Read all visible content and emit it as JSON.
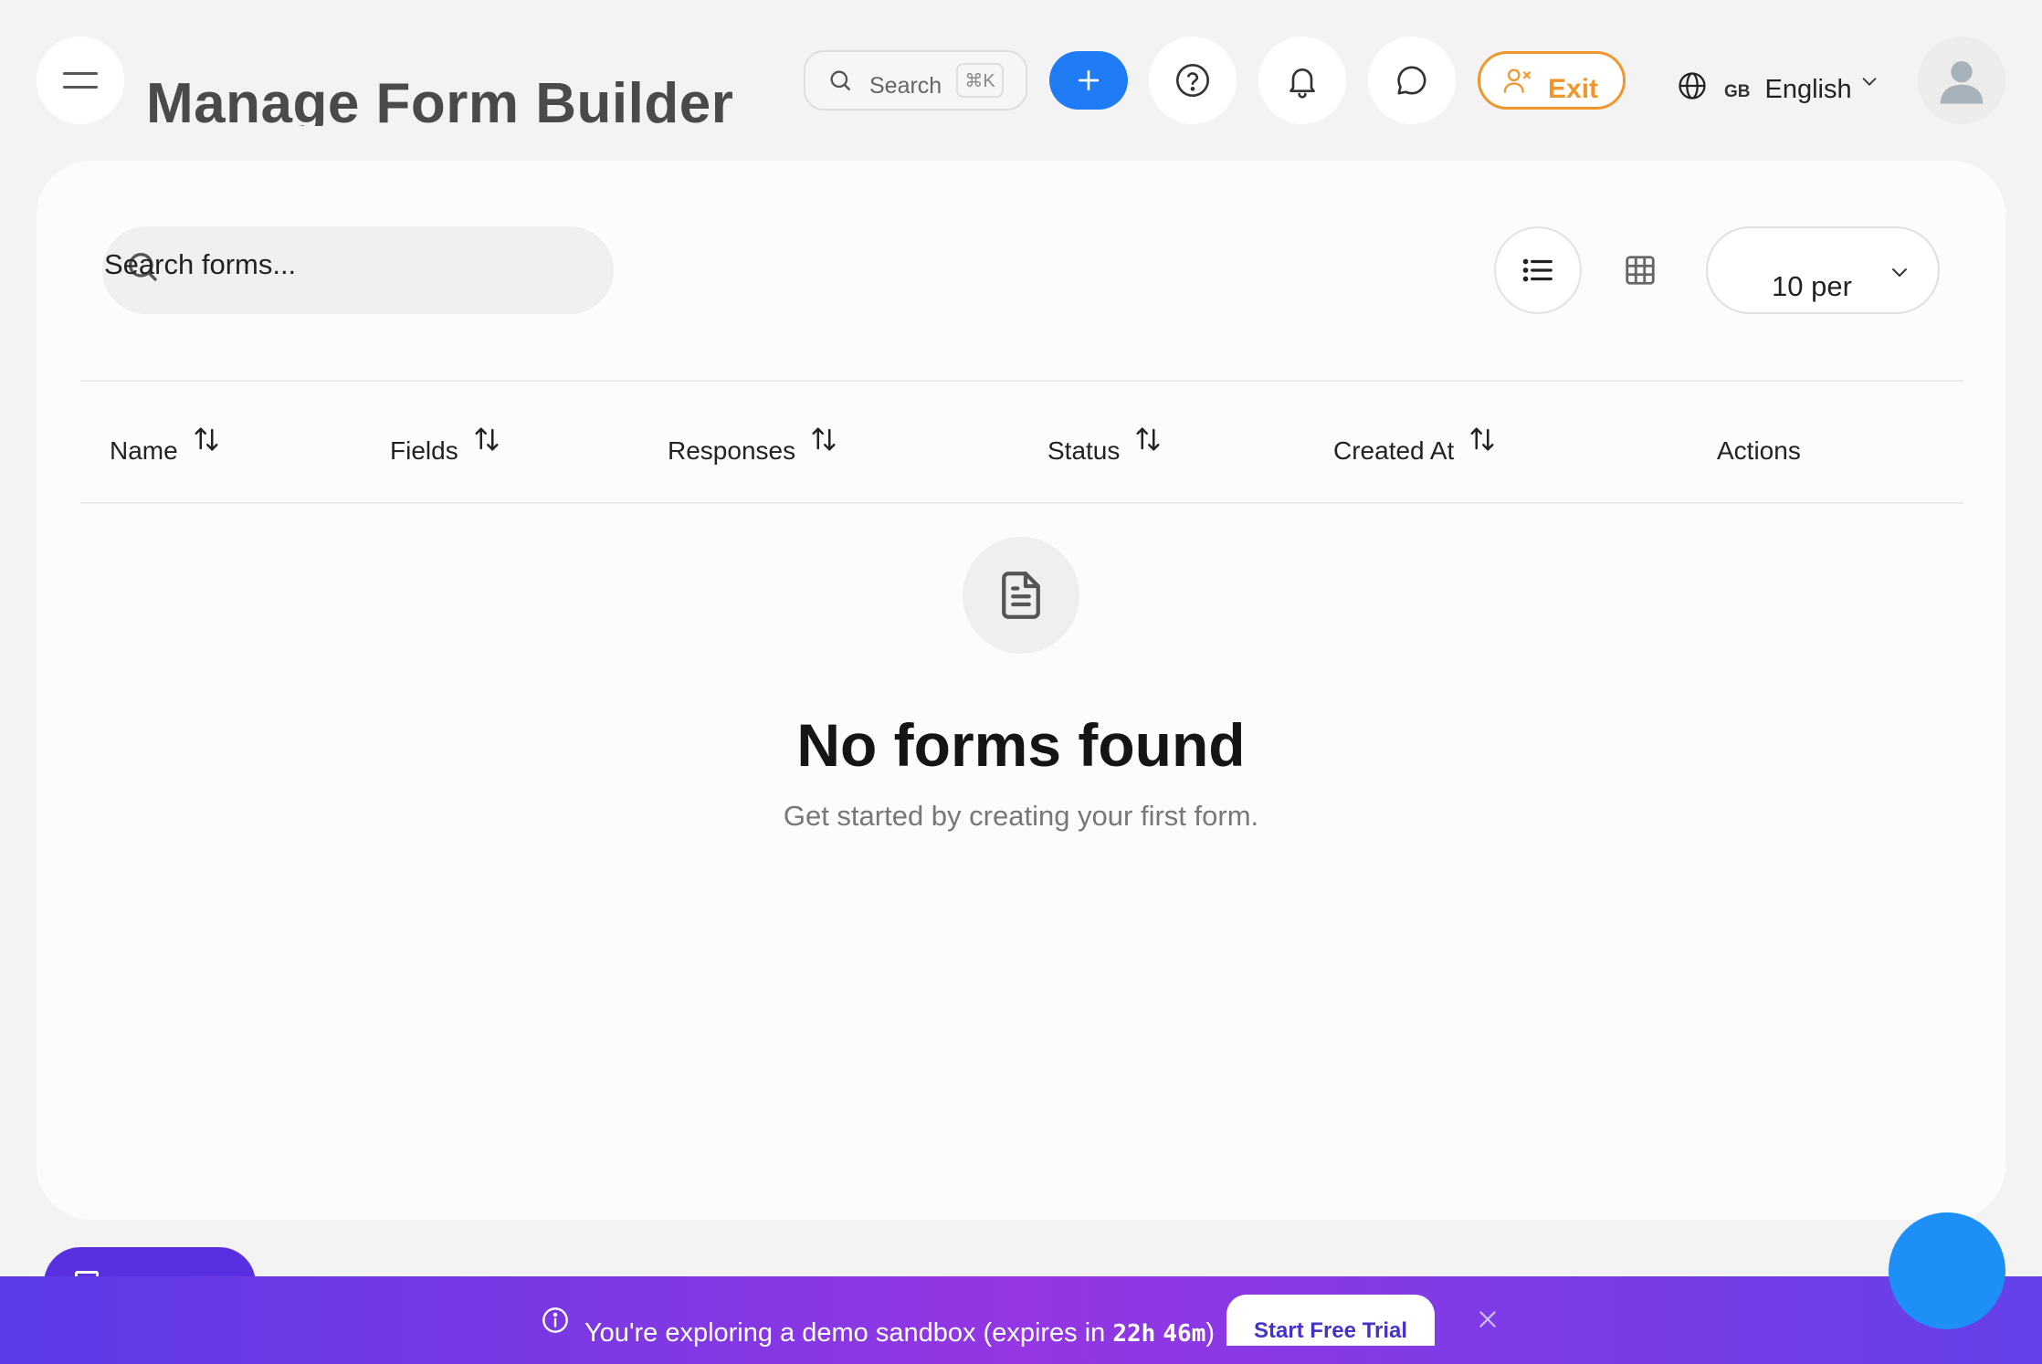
{
  "header": {
    "title": "Manage Form Builder",
    "search_label": "Search",
    "search_shortcut": "⌘K",
    "exit_label": "Exit",
    "language_code": "GB",
    "language_name": "English"
  },
  "toolbar": {
    "search_placeholder": "Search forms...",
    "per_page_value": "10 per"
  },
  "table": {
    "columns": [
      "Name",
      "Fields",
      "Responses",
      "Status",
      "Created At",
      "Actions"
    ]
  },
  "empty_state": {
    "title": "No forms found",
    "subtitle": "Get started by creating your first form."
  },
  "banner": {
    "message": "You're exploring a demo sandbox (expires in ",
    "time_hours": "22h",
    "time_minutes": "46m",
    "message_end": ")",
    "cta": "Start Free Trial"
  },
  "colors": {
    "primary": "#1f7cf5",
    "exit": "#f0962a",
    "banner_start": "#5b3be6",
    "banner_mid": "#9436e3",
    "fab": "#1e8ff7"
  },
  "icons": [
    "menu-icon",
    "search-icon",
    "plus-icon",
    "help-icon",
    "bell-icon",
    "chat-icon",
    "user-x-icon",
    "globe-icon",
    "chevron-down-icon",
    "user-avatar-icon",
    "list-view-icon",
    "grid-view-icon",
    "sort-icon",
    "document-icon",
    "info-icon",
    "close-icon"
  ]
}
